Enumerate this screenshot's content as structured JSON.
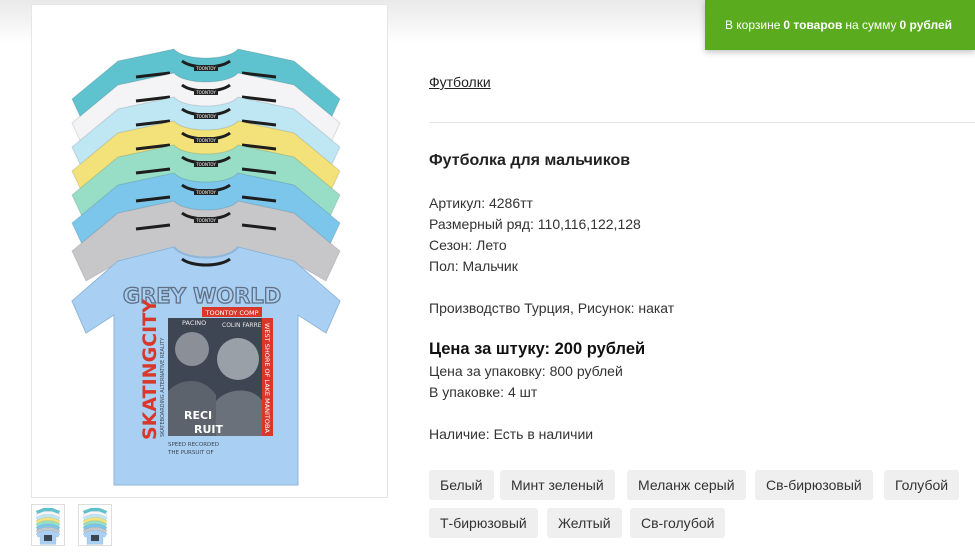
{
  "cart": {
    "prefix": "В корзине",
    "count": "0 товаров",
    "middle": "на сумму",
    "sum": "0 рублей"
  },
  "breadcrumb": "Футболки",
  "product": {
    "title": "Футболка для мальчиков",
    "article": "Артикул: 4286тт",
    "sizes": "Размерный ряд: 110,116,122,128",
    "season": "Сезон: Лето",
    "gender": "Пол: Мальчик",
    "production": "Производство Турция, Рисунок: накат",
    "price_unit": "Цена за штуку: 200 рублей",
    "price_pack": "Цена за упаковку: 800 рублей",
    "pack_qty": "В упаковке: 4 шт",
    "availability": "Наличие: Есть в наличии"
  },
  "print_text": {
    "grey_world": "GREY WORLD",
    "skating_city": "SKATINGCITY",
    "brand": "TOONTOY COMP",
    "pacino": "PACINO",
    "farrell": "COLIN FARRELL",
    "side": "WEST SHORE OF LAKE MANITOBA",
    "sub": "SKATEBOARDING ALTERNATIVE REALITY",
    "reci": "RECI",
    "ruit": "RUIT",
    "speed": "SPEED RECORDED",
    "pursuit": "THE PURSUIT OF",
    "label": "TOONTOY"
  },
  "colors": [
    "Белый",
    "Минт зеленый",
    "Меланж серый",
    "Св-бирюзовый",
    "Голубой",
    "Т-бирюзовый",
    "Желтый",
    "Св-голубой"
  ],
  "theme": {
    "cart_green": "#5aab1e",
    "shirt_colors": [
      "#5fc3cf",
      "#f4f4f6",
      "#bfe6f3",
      "#f3e27a",
      "#98dec6",
      "#7cc6ec",
      "#c7c7c9",
      "#a9d0f2"
    ]
  }
}
